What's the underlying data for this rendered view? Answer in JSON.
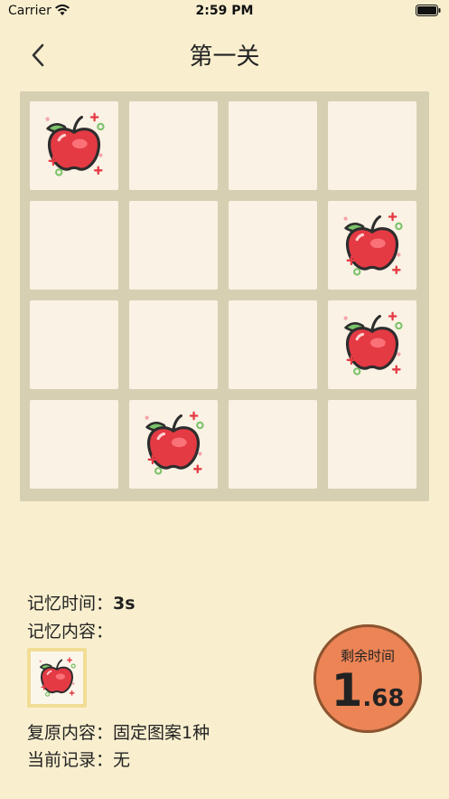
{
  "status_bar": {
    "carrier": "Carrier",
    "time": "2:59 PM"
  },
  "nav": {
    "title": "第一关",
    "back_icon": "chevron-left-icon"
  },
  "board": {
    "rows": 4,
    "cols": 4,
    "cells": [
      [
        "apple",
        "",
        "",
        ""
      ],
      [
        "",
        "",
        "",
        "apple"
      ],
      [
        "",
        "",
        "",
        "apple"
      ],
      [
        "",
        "apple",
        "",
        ""
      ]
    ]
  },
  "info": {
    "memory_time_label": "记忆时间：",
    "memory_time_value": "3s",
    "memory_content_label": "记忆内容：",
    "memory_content_icon": "apple-icon",
    "restore_content_label": "复原内容：",
    "restore_content_value": "固定图案1种",
    "current_record_label": "当前记录：",
    "current_record_value": "无"
  },
  "timer": {
    "label": "剩余时间",
    "value_int": "1",
    "value_frac": ".68"
  },
  "colors": {
    "background": "#f9efcf",
    "board": "#d6cfb2",
    "cell": "#faf2e4",
    "timer": "#ec8455",
    "timer_ring": "#8c5430",
    "apple_red": "#e43a44",
    "leaf_green": "#7cc36b"
  }
}
